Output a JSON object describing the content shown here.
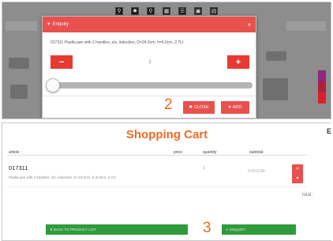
{
  "top_panel": {
    "toolbar": [
      {
        "name": "search-icon",
        "glyph": "⚲"
      },
      {
        "name": "settings-icon",
        "glyph": "✹"
      },
      {
        "name": "zoom-icon",
        "glyph": "⚲"
      },
      {
        "name": "grid-icon",
        "glyph": "▦"
      },
      {
        "name": "list-icon",
        "glyph": "☰"
      },
      {
        "name": "image-icon",
        "glyph": "▣"
      },
      {
        "name": "cart-icon",
        "glyph": "▤"
      }
    ],
    "modal": {
      "title": "Enquiry",
      "title_icon": "heart-icon",
      "close_glyph": "×",
      "description": "017311 Paella pan with 2 handles, s/s, induction, D=24.0cm, h=6.0cm, 2.7Lt",
      "minus_label": "−",
      "plus_label": "+",
      "quantity": "1",
      "slider_value": 0,
      "close_label": "CLOSE",
      "add_label": "ADD",
      "accent_color": "#e8514d"
    },
    "step_number": "2"
  },
  "bottom_panel": {
    "title": "Shopping Cart",
    "corner_icon": "E",
    "columns": {
      "article": "article",
      "price": "price",
      "quantity": "quantity",
      "subtotal": "subtotal"
    },
    "row": {
      "code": "017311",
      "description": "Paella pan with 2 handles, s/s, induction, D=24.0cm, h=6.0cm, 2.7Lt",
      "quantity": "1",
      "subtotal": "0.00 EUR"
    },
    "total_label": "total:",
    "back_button": "BACK TO PRODUCT LIST",
    "enquiry_button": "ENQUIRY",
    "step_number": "3",
    "title_color": "#f16a21",
    "button_color": "#2f9b3c"
  }
}
